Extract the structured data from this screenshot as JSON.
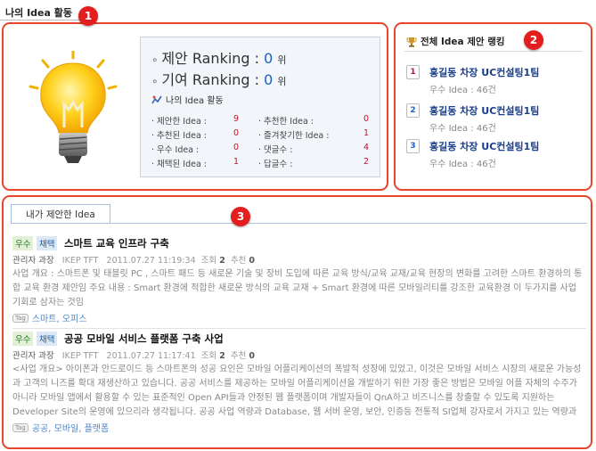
{
  "page": {
    "title": "나의 Idea 활동"
  },
  "badges": [
    "1",
    "2",
    "3"
  ],
  "activity": {
    "proposal_rank_label": "제안 Ranking : ",
    "proposal_rank_value": "0",
    "contrib_rank_label": "기여 Ranking : ",
    "contrib_rank_value": "0",
    "rank_unit": "위",
    "section_title": "나의 Idea 활동",
    "left": [
      {
        "label": "· 제안한 Idea :",
        "value": "9"
      },
      {
        "label": "· 추천된 Idea :",
        "value": "0"
      },
      {
        "label": "· 우수 Idea :",
        "value": "0"
      },
      {
        "label": "· 채택된 Idea :",
        "value": "1"
      }
    ],
    "right": [
      {
        "label": "· 추천한 Idea :",
        "value": "0"
      },
      {
        "label": "· 즐겨찾기한 Idea :",
        "value": "1"
      },
      {
        "label": "· 댓글수 :",
        "value": "4"
      },
      {
        "label": "· 답글수 :",
        "value": "2"
      }
    ]
  },
  "ranking": {
    "title": "전체 Idea 제안 랭킹",
    "items": [
      {
        "rank": "1",
        "name": "홍길동 차장  UC컨설팅1팀",
        "count": "우수 Idea : 46건",
        "color": "#c8102e"
      },
      {
        "rank": "2",
        "name": "홍길동 차장  UC컨설팅1팀",
        "count": "우수 Idea : 46건",
        "color": "#1a62c4"
      },
      {
        "rank": "3",
        "name": "홍길동 차장  UC컨설팅1팀",
        "count": "우수 Idea : 46건",
        "color": "#1a62c4"
      }
    ]
  },
  "proposals": {
    "tab": "내가 제안한 Idea",
    "posts": [
      {
        "tag1": "우수",
        "tag2": "채택",
        "title": "스마트 교육 인프라 구축",
        "author": "관리자 과장",
        "org": "IKEP TFT",
        "date": "2011.07.27 11:19:34",
        "views_label": "조회",
        "views": "2",
        "rec_label": "추천",
        "recs": "0",
        "body": "사업 개요 : 스마트폰 및 태블릿 PC , 스마트 패드 등 새로운 기술 및 장비 도입에 따른 교육 방식/교육 교재/교육 현장의 변화를 고려한 스마트 환경하의 통합 교육 환경 제안임   주요 내용 : Smart 환경에 적합한 새로운 방식의 교육 교재 + Smart 환경에 따른 모바일리티를 강조한 교육환경 이 두가지를 사업 기회로 삼자는 것임",
        "tag_icon": "Tag",
        "tags": "스마트, 오피스"
      },
      {
        "tag1": "우수",
        "tag2": "채택",
        "title": "공공 모바일 서비스 플랫폼 구축 사업",
        "author": "관리자 과장",
        "org": "IKEP TFT",
        "date": "2011.07.27 11:17:41",
        "views_label": "조회",
        "views": "2",
        "rec_label": "추천",
        "recs": "0",
        "body": "<사업 개요> 아이폰과 안드로이드 등 스마트폰의 성공 요인은 모바일 어플리케이션의 폭발적 성장에 있었고, 이것은 모바일 서비스 시장의 새로운 가능성과 고객의 니즈를 확대 재생산하고 있습니다. 공공 서비스를 제공하는 모바일 어플리케이션을 개발하기 위한 가장 좋은 방법은 모바일 어플 자체의 수주가 아니라 모바일 앱에서 활용할 수 있는 표준적인 Open API들과 안정된 웹 플랫폼이며 개발자들이 QnA하고 비즈니스를 창출할 수 있도록 지원하는 Developer Site의 운영에 있으리라 생각됩니다.   공공 사업 역량과 Database, 웹 서버 운영, 보안, 인증등 전통적 SI업체 강자로서 가지고 있는 역량과",
        "tag_icon": "Tag",
        "tags": "공공, 모바일, 플랫폼"
      }
    ]
  },
  "colors": {
    "accent_border": "#e8452c",
    "badge": "#e41e1e",
    "rank_value": "#1a62c4",
    "count_value": "#c8102e"
  }
}
